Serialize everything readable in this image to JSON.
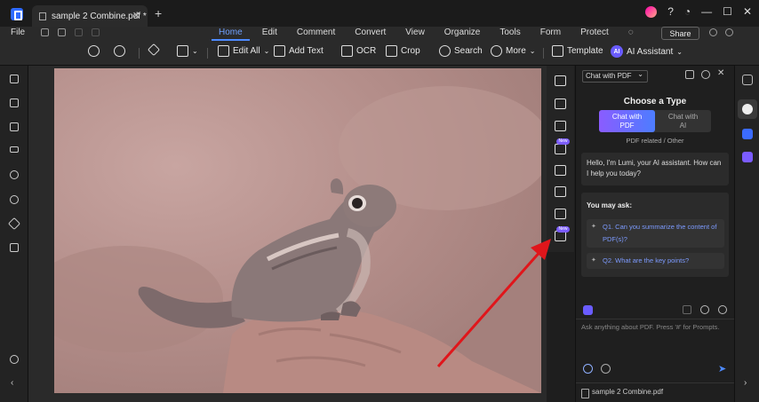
{
  "tab": {
    "title": "sample 2 Combine.pdf *",
    "close": "✕",
    "add": "+"
  },
  "window": {
    "minimize": "—",
    "maximize": "☐",
    "close": "✕",
    "help": "?",
    "notify": "◔"
  },
  "menu": {
    "file": "File",
    "tabs": [
      "Home",
      "Edit",
      "Comment",
      "Convert",
      "View",
      "Organize",
      "Tools",
      "Form",
      "Protect"
    ],
    "share": "Share"
  },
  "toolbar": {
    "edit_all": "Edit All",
    "add_text": "Add Text",
    "ocr": "OCR",
    "crop": "Crop",
    "search": "Search",
    "more": "More",
    "template": "Template",
    "ai_assistant": "AI Assistant",
    "ai_badge": "AI"
  },
  "strip_badges": {
    "new1": "New",
    "new2": "New"
  },
  "ai_panel": {
    "mode_select": "Chat with PDF",
    "choose_title": "Choose a Type",
    "type_pdf": "Chat with PDF",
    "type_ai": "Chat with AI",
    "type_note": "PDF related / Other",
    "greeting": "Hello, I'm Lumi, your AI assistant. How can I help you today?",
    "you_may_ask": "You may ask:",
    "q1": "Q1. Can you summarize the content of PDF(s)?",
    "q2": "Q2. What are the key points?",
    "input_placeholder": "Ask anything about PDF. Press '#' for Prompts.",
    "file_chip": "sample 2 Combine.pdf"
  },
  "colors": {
    "accent": "#4e8bff",
    "arrow": "#e0161b",
    "badge": "#7b5cff"
  }
}
